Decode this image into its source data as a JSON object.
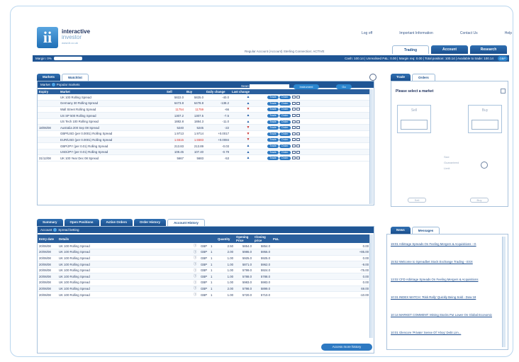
{
  "brand": {
    "name": "interactive",
    "name2": "investor",
    "url": "www.iii.co.uk",
    "logo_letter": "ii"
  },
  "top_links": [
    "Log off",
    "Important Information",
    "Contact Us",
    "Help"
  ],
  "account_line": "Regular Account (Account)  Sterling  Connection: ACTIVE",
  "main_tabs": [
    "Trading",
    "Account",
    "Research"
  ],
  "status_bar": {
    "margin_label": "Margin: 0%",
    "cash": "Cash: 100.14 | Unrealised P&L: 0.00 | Margin req: 0.00 | Total position: 100.14 | Available to trade: 100.14",
    "currency": "GBP"
  },
  "markets": {
    "tabs": [
      "Markets",
      "Watchlist"
    ],
    "header_label": "Market",
    "header_selected": "Popular markets",
    "search_label": "Search:",
    "instrument_btn": "Instrument",
    "go_btn": "Go",
    "columns": [
      "Expiry",
      "Market",
      "Sell",
      "Buy",
      "Daily change",
      "Last change"
    ],
    "trade_label": "Trade",
    "order_label": "Order",
    "rows": [
      {
        "expiry": "",
        "market": "UK 100 Rolling Spread",
        "sell": "5822.0",
        "buy": "5825.0",
        "change": "-40.0",
        "dir": "up",
        "red": false
      },
      {
        "expiry": "",
        "market": "Germany 30 Rolling Spread",
        "sell": "6473.8",
        "buy": "6478.8",
        "change": "-138.2",
        "dir": "up",
        "red": false
      },
      {
        "expiry": "",
        "market": "Wall Street Rolling Spread",
        "sell": "11754",
        "buy": "11759",
        "change": "-66",
        "dir": "down",
        "red": true
      },
      {
        "expiry": "",
        "market": "US SP 500 Rolling Spread",
        "sell": "1307.2",
        "buy": "1307.5",
        "change": "-7.5",
        "dir": "up",
        "red": false
      },
      {
        "expiry": "",
        "market": "US Tech 100 Rolling Spread",
        "sell": "1882.8",
        "buy": "1884.3",
        "change": "-11.0",
        "dir": "up",
        "red": false
      },
      {
        "expiry": "18/06/08",
        "market": "Australia 200 Sep 08 Spread",
        "sell": "5240",
        "buy": "5245",
        "change": "-22",
        "dir": "down",
        "red": false
      },
      {
        "expiry": "",
        "market": "GBP/USD (per 0.0001) Rolling Spread",
        "sell": "1.9713",
        "buy": "1.9714",
        "change": "+0.0017",
        "dir": "down",
        "red": false
      },
      {
        "expiry": "",
        "market": "EUR/USD (per 0.0001) Rolling Spread",
        "sell": "1.5515",
        "buy": "1.5583",
        "change": "+0.0084",
        "dir": "down",
        "red": true
      },
      {
        "expiry": "",
        "market": "GBP/JPY (per 0.01) Rolling Spread",
        "sell": "213.83",
        "buy": "213.89",
        "change": "-0.03",
        "dir": "up",
        "red": false
      },
      {
        "expiry": "",
        "market": "USD/JPY (per 0.01) Rolling Spread",
        "sell": "108.45",
        "buy": "107.40",
        "change": "-0.79",
        "dir": "up",
        "red": false
      },
      {
        "expiry": "31/12/08",
        "market": "UK 100 Year Dec 08 Spread",
        "sell": "5667",
        "buy": "5683",
        "change": "-53",
        "dir": "up",
        "red": false
      }
    ]
  },
  "ticket": {
    "tabs": [
      "Trade",
      "Orders"
    ],
    "title": "Please select a market",
    "sell": "Sell",
    "buy": "Buy",
    "labels": [
      "Size",
      "Guaranteed",
      "Limit"
    ],
    "btn1": "Sell",
    "btn2": "Buy"
  },
  "history": {
    "tabs": [
      "Summary",
      "Open Positions",
      "Active Orders",
      "Order History",
      "Account History"
    ],
    "header_label": "Account",
    "header_selected": "Spread betting",
    "columns": [
      "Entry date",
      "Details",
      "",
      "",
      "",
      "Quantity",
      "Opening Price",
      "Closing price",
      "P&L"
    ],
    "rows": [
      {
        "date": "20/06/08",
        "details": "UK 100 Rolling Spread",
        "cur": "GBP",
        "q": "1",
        "qty": "2.50",
        "open": "5854.0",
        "close": "5854.0",
        "pl": "0.00"
      },
      {
        "date": "20/06/08",
        "details": "UK 100 Rolling Spread",
        "cur": "GBP",
        "q": "1",
        "qty": "2.00",
        "open": "5986.0",
        "close": "5956.0",
        "pl": "+85.00"
      },
      {
        "date": "20/06/08",
        "details": "UK 100 Rolling Spread",
        "cur": "GBP",
        "q": "1",
        "qty": "1.00",
        "open": "5925.0",
        "close": "5925.0",
        "pl": "0.00"
      },
      {
        "date": "20/06/08",
        "details": "UK 100 Rolling Spread",
        "cur": "GBP",
        "q": "1",
        "qty": "1.00",
        "open": "5871.0",
        "close": "5962.0",
        "pl": "-9.00"
      },
      {
        "date": "20/06/08",
        "details": "UK 100 Rolling Spread",
        "cur": "GBP",
        "q": "1",
        "qty": "1.00",
        "open": "5799.0",
        "close": "5924.0",
        "pl": "-75.00"
      },
      {
        "date": "20/06/08",
        "details": "UK 100 Rolling Spread",
        "cur": "GBP",
        "q": "1",
        "qty": "1.00",
        "open": "5788.0",
        "close": "5788.0",
        "pl": "0.00"
      },
      {
        "date": "20/06/08",
        "details": "UK 100 Rolling Spread",
        "cur": "GBP",
        "q": "1",
        "qty": "1.00",
        "open": "5983.0",
        "close": "5983.0",
        "pl": "0.00"
      },
      {
        "date": "20/06/08",
        "details": "UK 100 Rolling Spread",
        "cur": "GBP",
        "q": "1",
        "qty": "2.00",
        "open": "5798.0",
        "close": "5899.0",
        "pl": "69.00"
      },
      {
        "date": "20/06/08",
        "details": "UK 100 Rolling Spread",
        "cur": "GBP",
        "q": "1",
        "qty": "1.00",
        "open": "5720.0",
        "close": "5710.0",
        "pl": "-10.00"
      }
    ],
    "footer_button": "Access more history"
  },
  "news": {
    "tabs": [
      "News",
      "Messages"
    ],
    "items": [
      "19:01 Arbitrage Spreads On Feeling Mergers & Acquisitions - G",
      "15:52 Welcome to Spreadbet Stock Exchange Trading - ESX",
      "13:02 CFD Arbitrage Spreads On Feeling Mergers & Acquisitions",
      "10:31 INDEX WATCH: 'Risk Rally' Quickly Being Sold - Dow 18",
      "10:14 MARKET COMMENT: Mining Stocks Put Lower On Global Economic",
      "10:01 Glencore 'Private' Sense Of 'Ahoy' Debt Lim..."
    ]
  },
  "colors": {
    "brand_blue": "#1f5594",
    "accent": "#2b86cf",
    "down_red": "#c63232"
  }
}
